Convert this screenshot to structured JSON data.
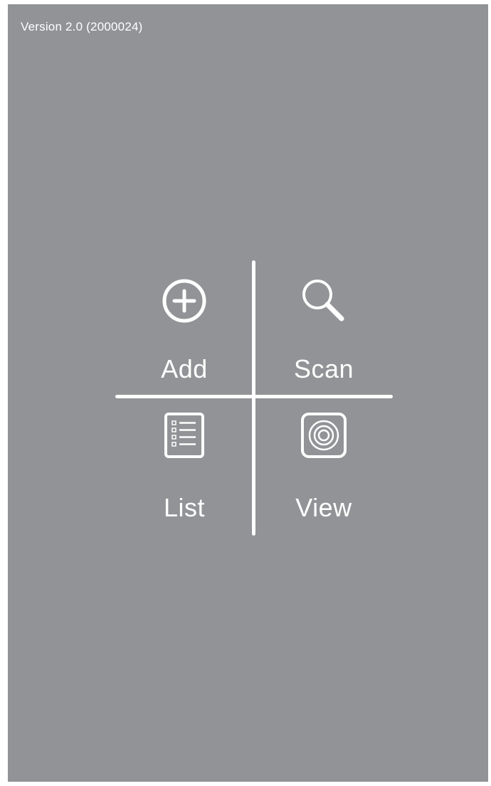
{
  "app": {
    "version": "Version 2.0 (2000024)"
  },
  "menu": {
    "add": {
      "label": "Add",
      "icon": "plus-circle-icon"
    },
    "scan": {
      "label": "Scan",
      "icon": "search-icon"
    },
    "list": {
      "label": "List",
      "icon": "checklist-icon"
    },
    "view": {
      "label": "View",
      "icon": "target-square-icon"
    }
  },
  "colors": {
    "background": "#929396",
    "foreground": "#ffffff"
  }
}
